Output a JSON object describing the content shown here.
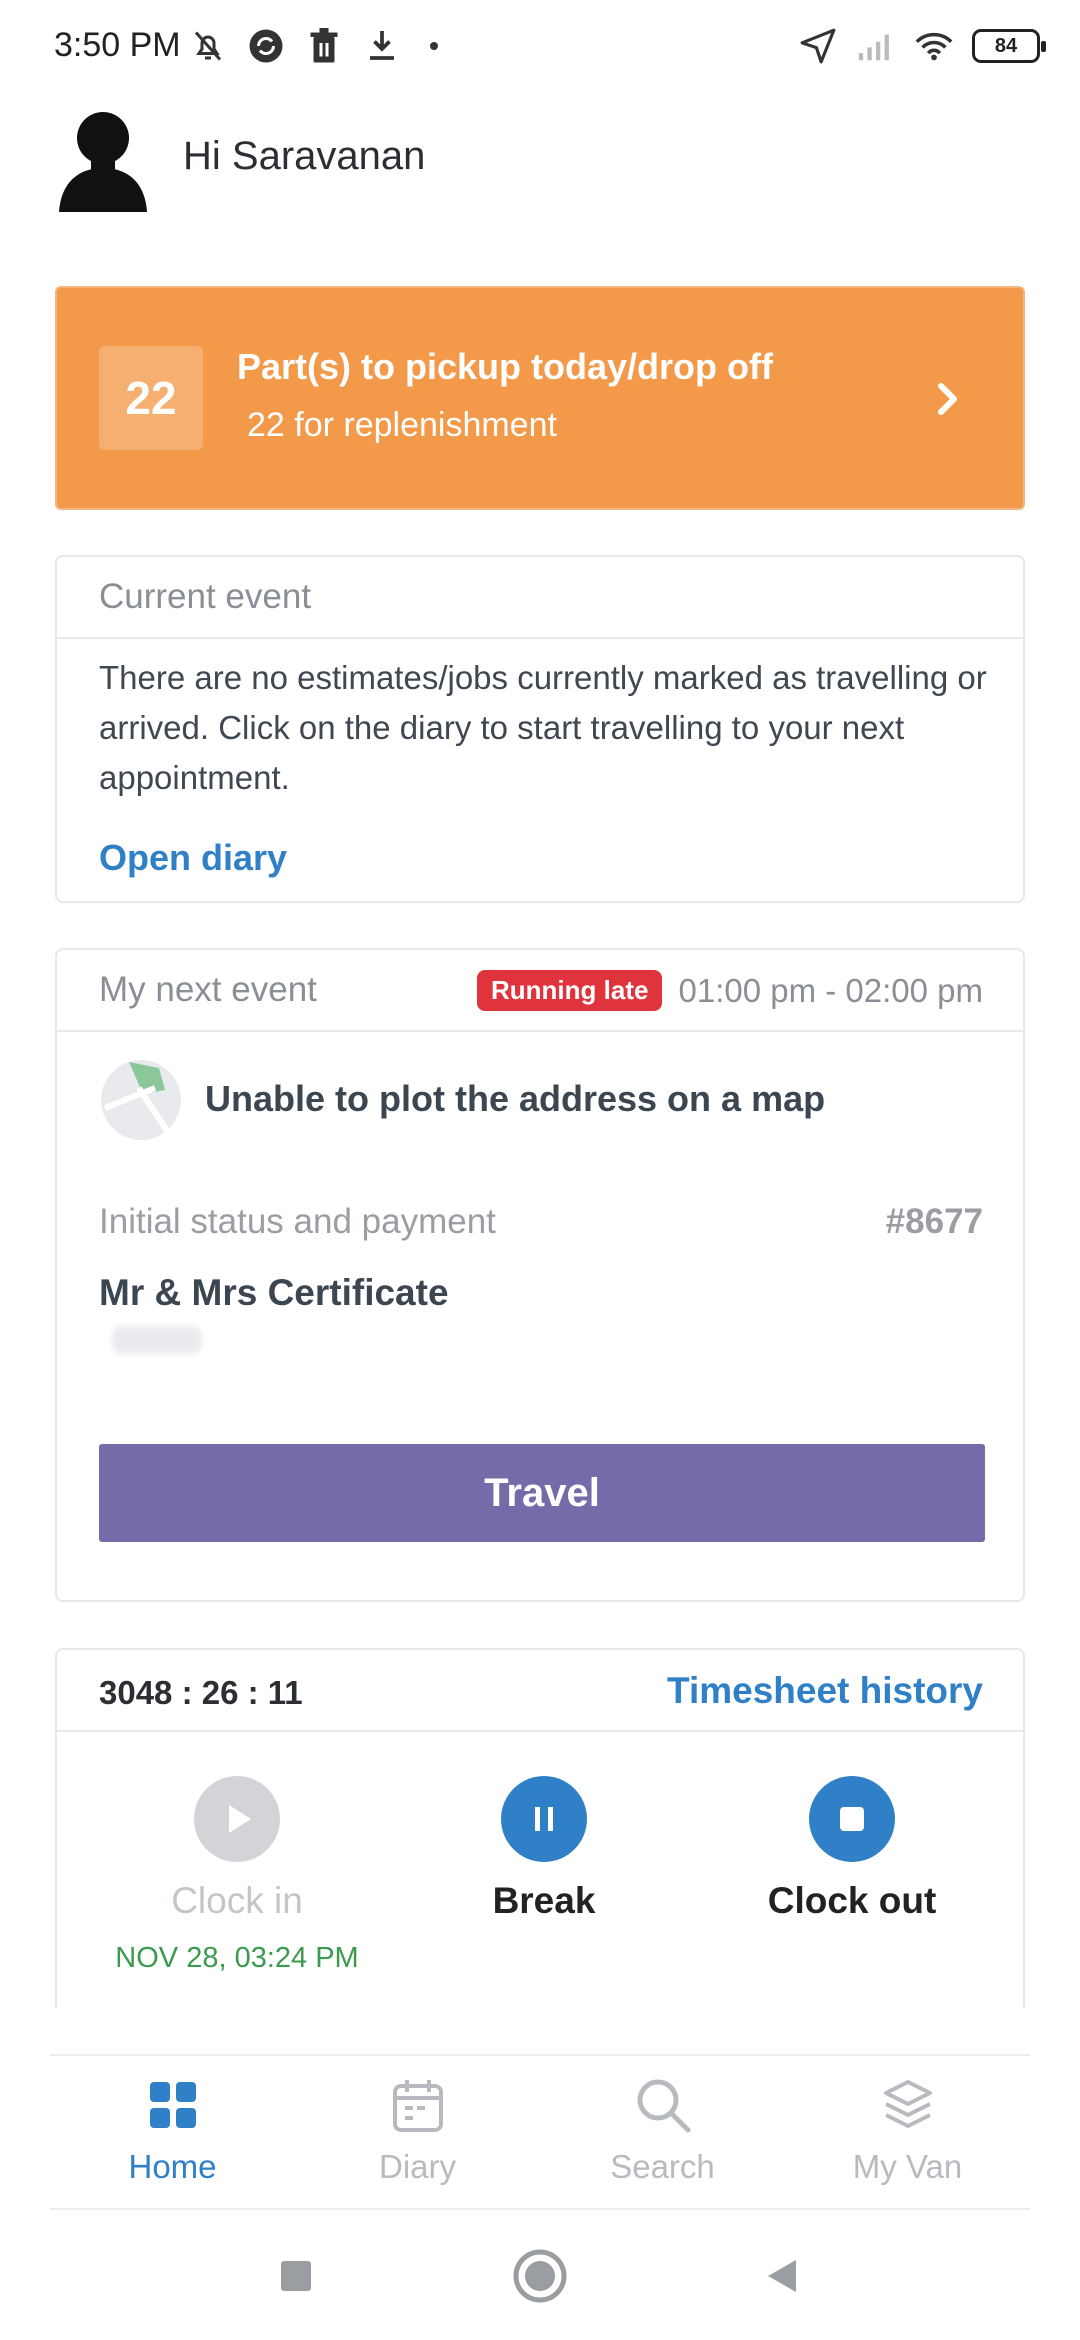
{
  "status_bar": {
    "time": "3:50 PM",
    "battery": "84",
    "icons_left": [
      "bell-off-icon",
      "sync-icon",
      "trash-icon",
      "download-icon"
    ],
    "icons_right": [
      "location-arrow-icon",
      "signal-icon",
      "wifi-icon",
      "battery-icon"
    ]
  },
  "header": {
    "greeting": "Hi Saravanan"
  },
  "pickup": {
    "count": "22",
    "title": "Part(s) to pickup today/drop off",
    "subtitle": "22 for replenishment",
    "color": "#f2994a"
  },
  "current_event": {
    "title": "Current event",
    "message": "There are no estimates/jobs currently marked as travelling or arrived. Click on the diary to start travelling to your next appointment.",
    "link": "Open diary"
  },
  "next_event": {
    "title": "My next event",
    "badge": "Running late",
    "time_range": "01:00 pm - 02:00 pm",
    "map_message": "Unable to plot the address on a map",
    "status_label": "Initial status and payment",
    "job_number": "#8677",
    "customer": "Mr & Mrs Certificate",
    "action": "Travel",
    "action_color": "#756ba8"
  },
  "timesheet": {
    "timer": "3048 : 26 : 11",
    "history_link": "Timesheet history",
    "clock_in_label": "Clock in",
    "clock_in_time": "NOV 28, 03:24 PM",
    "break_label": "Break",
    "clock_out_label": "Clock out"
  },
  "bottom_nav": {
    "items": [
      {
        "label": "Home",
        "icon": "grid-icon",
        "active": true
      },
      {
        "label": "Diary",
        "icon": "calendar-icon",
        "active": false
      },
      {
        "label": "Search",
        "icon": "search-icon",
        "active": false
      },
      {
        "label": "My Van",
        "icon": "layers-icon",
        "active": false
      }
    ]
  },
  "colors": {
    "accent": "#2f80c7",
    "late": "#e0343c",
    "clock_in_time": "#3b9a4d"
  }
}
